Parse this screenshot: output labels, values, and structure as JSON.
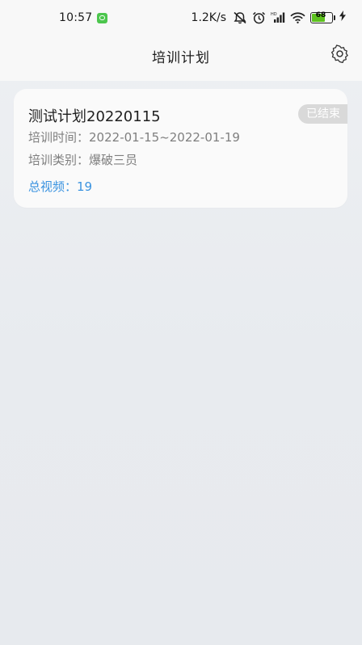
{
  "status_bar": {
    "time": "10:57",
    "net_speed": "1.2K/s",
    "battery_level": "68",
    "battery_fraction": 0.68,
    "icons": [
      "wechat-icon",
      "mute-icon",
      "alarm-icon",
      "signal-icon",
      "wifi-icon",
      "battery-icon",
      "charging-icon"
    ]
  },
  "header": {
    "title": "培训计划",
    "settings_icon": "gear-icon"
  },
  "plans": [
    {
      "title": "测试计划20220115",
      "status": "已结束",
      "time_label": "培训时间：",
      "time_value": "2022-01-15~2022-01-19",
      "category_label": "培训类别：",
      "category_value": "爆破三员",
      "videos_label": "总视频：",
      "videos_value": "19"
    }
  ],
  "colors": {
    "accent": "#3a93e0",
    "badge_bg": "#d9d9d9",
    "battery": "#5dc21e"
  }
}
